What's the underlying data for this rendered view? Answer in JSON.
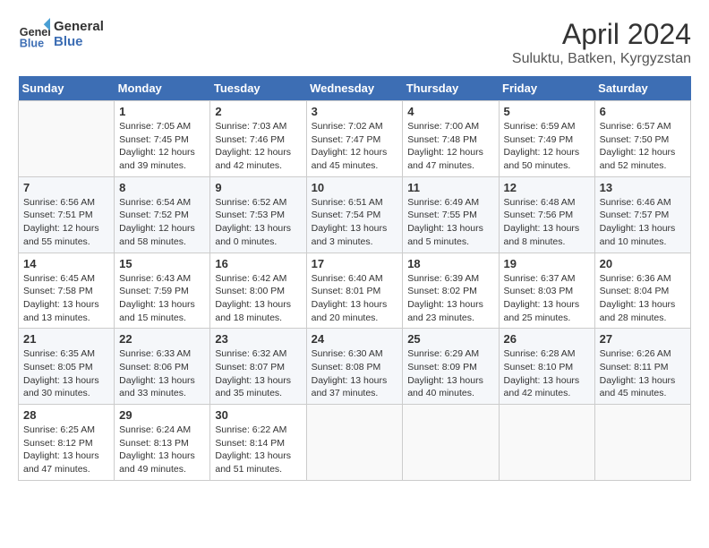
{
  "header": {
    "logo_line1": "General",
    "logo_line2": "Blue",
    "month_title": "April 2024",
    "location": "Suluktu, Batken, Kyrgyzstan"
  },
  "weekdays": [
    "Sunday",
    "Monday",
    "Tuesday",
    "Wednesday",
    "Thursday",
    "Friday",
    "Saturday"
  ],
  "weeks": [
    [
      {
        "day": "",
        "sunrise": "",
        "sunset": "",
        "daylight": ""
      },
      {
        "day": "1",
        "sunrise": "Sunrise: 7:05 AM",
        "sunset": "Sunset: 7:45 PM",
        "daylight": "Daylight: 12 hours and 39 minutes."
      },
      {
        "day": "2",
        "sunrise": "Sunrise: 7:03 AM",
        "sunset": "Sunset: 7:46 PM",
        "daylight": "Daylight: 12 hours and 42 minutes."
      },
      {
        "day": "3",
        "sunrise": "Sunrise: 7:02 AM",
        "sunset": "Sunset: 7:47 PM",
        "daylight": "Daylight: 12 hours and 45 minutes."
      },
      {
        "day": "4",
        "sunrise": "Sunrise: 7:00 AM",
        "sunset": "Sunset: 7:48 PM",
        "daylight": "Daylight: 12 hours and 47 minutes."
      },
      {
        "day": "5",
        "sunrise": "Sunrise: 6:59 AM",
        "sunset": "Sunset: 7:49 PM",
        "daylight": "Daylight: 12 hours and 50 minutes."
      },
      {
        "day": "6",
        "sunrise": "Sunrise: 6:57 AM",
        "sunset": "Sunset: 7:50 PM",
        "daylight": "Daylight: 12 hours and 52 minutes."
      }
    ],
    [
      {
        "day": "7",
        "sunrise": "Sunrise: 6:56 AM",
        "sunset": "Sunset: 7:51 PM",
        "daylight": "Daylight: 12 hours and 55 minutes."
      },
      {
        "day": "8",
        "sunrise": "Sunrise: 6:54 AM",
        "sunset": "Sunset: 7:52 PM",
        "daylight": "Daylight: 12 hours and 58 minutes."
      },
      {
        "day": "9",
        "sunrise": "Sunrise: 6:52 AM",
        "sunset": "Sunset: 7:53 PM",
        "daylight": "Daylight: 13 hours and 0 minutes."
      },
      {
        "day": "10",
        "sunrise": "Sunrise: 6:51 AM",
        "sunset": "Sunset: 7:54 PM",
        "daylight": "Daylight: 13 hours and 3 minutes."
      },
      {
        "day": "11",
        "sunrise": "Sunrise: 6:49 AM",
        "sunset": "Sunset: 7:55 PM",
        "daylight": "Daylight: 13 hours and 5 minutes."
      },
      {
        "day": "12",
        "sunrise": "Sunrise: 6:48 AM",
        "sunset": "Sunset: 7:56 PM",
        "daylight": "Daylight: 13 hours and 8 minutes."
      },
      {
        "day": "13",
        "sunrise": "Sunrise: 6:46 AM",
        "sunset": "Sunset: 7:57 PM",
        "daylight": "Daylight: 13 hours and 10 minutes."
      }
    ],
    [
      {
        "day": "14",
        "sunrise": "Sunrise: 6:45 AM",
        "sunset": "Sunset: 7:58 PM",
        "daylight": "Daylight: 13 hours and 13 minutes."
      },
      {
        "day": "15",
        "sunrise": "Sunrise: 6:43 AM",
        "sunset": "Sunset: 7:59 PM",
        "daylight": "Daylight: 13 hours and 15 minutes."
      },
      {
        "day": "16",
        "sunrise": "Sunrise: 6:42 AM",
        "sunset": "Sunset: 8:00 PM",
        "daylight": "Daylight: 13 hours and 18 minutes."
      },
      {
        "day": "17",
        "sunrise": "Sunrise: 6:40 AM",
        "sunset": "Sunset: 8:01 PM",
        "daylight": "Daylight: 13 hours and 20 minutes."
      },
      {
        "day": "18",
        "sunrise": "Sunrise: 6:39 AM",
        "sunset": "Sunset: 8:02 PM",
        "daylight": "Daylight: 13 hours and 23 minutes."
      },
      {
        "day": "19",
        "sunrise": "Sunrise: 6:37 AM",
        "sunset": "Sunset: 8:03 PM",
        "daylight": "Daylight: 13 hours and 25 minutes."
      },
      {
        "day": "20",
        "sunrise": "Sunrise: 6:36 AM",
        "sunset": "Sunset: 8:04 PM",
        "daylight": "Daylight: 13 hours and 28 minutes."
      }
    ],
    [
      {
        "day": "21",
        "sunrise": "Sunrise: 6:35 AM",
        "sunset": "Sunset: 8:05 PM",
        "daylight": "Daylight: 13 hours and 30 minutes."
      },
      {
        "day": "22",
        "sunrise": "Sunrise: 6:33 AM",
        "sunset": "Sunset: 8:06 PM",
        "daylight": "Daylight: 13 hours and 33 minutes."
      },
      {
        "day": "23",
        "sunrise": "Sunrise: 6:32 AM",
        "sunset": "Sunset: 8:07 PM",
        "daylight": "Daylight: 13 hours and 35 minutes."
      },
      {
        "day": "24",
        "sunrise": "Sunrise: 6:30 AM",
        "sunset": "Sunset: 8:08 PM",
        "daylight": "Daylight: 13 hours and 37 minutes."
      },
      {
        "day": "25",
        "sunrise": "Sunrise: 6:29 AM",
        "sunset": "Sunset: 8:09 PM",
        "daylight": "Daylight: 13 hours and 40 minutes."
      },
      {
        "day": "26",
        "sunrise": "Sunrise: 6:28 AM",
        "sunset": "Sunset: 8:10 PM",
        "daylight": "Daylight: 13 hours and 42 minutes."
      },
      {
        "day": "27",
        "sunrise": "Sunrise: 6:26 AM",
        "sunset": "Sunset: 8:11 PM",
        "daylight": "Daylight: 13 hours and 45 minutes."
      }
    ],
    [
      {
        "day": "28",
        "sunrise": "Sunrise: 6:25 AM",
        "sunset": "Sunset: 8:12 PM",
        "daylight": "Daylight: 13 hours and 47 minutes."
      },
      {
        "day": "29",
        "sunrise": "Sunrise: 6:24 AM",
        "sunset": "Sunset: 8:13 PM",
        "daylight": "Daylight: 13 hours and 49 minutes."
      },
      {
        "day": "30",
        "sunrise": "Sunrise: 6:22 AM",
        "sunset": "Sunset: 8:14 PM",
        "daylight": "Daylight: 13 hours and 51 minutes."
      },
      {
        "day": "",
        "sunrise": "",
        "sunset": "",
        "daylight": ""
      },
      {
        "day": "",
        "sunrise": "",
        "sunset": "",
        "daylight": ""
      },
      {
        "day": "",
        "sunrise": "",
        "sunset": "",
        "daylight": ""
      },
      {
        "day": "",
        "sunrise": "",
        "sunset": "",
        "daylight": ""
      }
    ]
  ]
}
